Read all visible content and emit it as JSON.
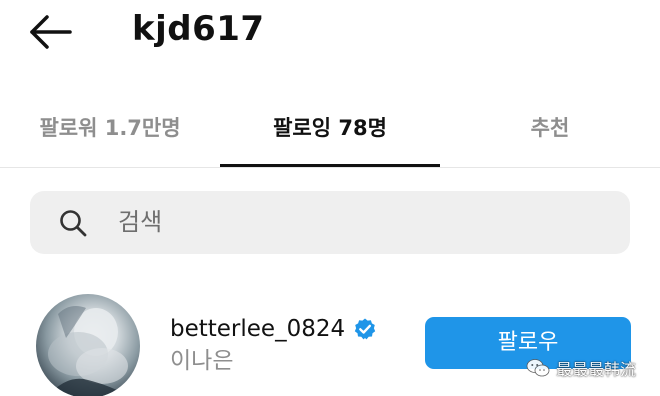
{
  "header": {
    "title": "kjd617",
    "back_icon": "arrow-left-icon"
  },
  "tabs": [
    {
      "label": "팔로워 1.7만명",
      "active": false
    },
    {
      "label": "팔로잉 78명",
      "active": true
    },
    {
      "label": "추천",
      "active": false
    }
  ],
  "search": {
    "placeholder": "검색",
    "icon": "search-icon"
  },
  "list": [
    {
      "username": "betterlee_0824",
      "full_name": "이나은",
      "verified": true,
      "button_label": "팔로우"
    }
  ],
  "watermark": {
    "text": "最最最韩流",
    "icon": "wechat-icon"
  },
  "colors": {
    "accent": "#1f95e8",
    "verified": "#1f95e8",
    "muted_text": "#8e8e8e",
    "search_bg": "#efefef"
  }
}
